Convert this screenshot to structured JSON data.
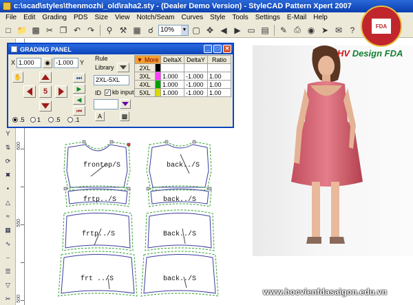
{
  "window": {
    "title": "c:\\scad\\styles\\thenmozhi_old\\raha2.sty - (Dealer Demo Version) - StyleCAD Pattern Xpert 2007"
  },
  "menu": [
    "File",
    "Edit",
    "Grading",
    "PDS",
    "Size",
    "View",
    "Notch/Seam",
    "Curves",
    "Style",
    "Tools",
    "Settings",
    "E-Mail",
    "Help"
  ],
  "toolbar": {
    "zoom": "10%"
  },
  "ruler": {
    "labels": [
      "600",
      "550",
      "500"
    ]
  },
  "grading_panel": {
    "title": "GRADING PANEL",
    "x_value": "1.000",
    "x_label": "X",
    "y_value": "-1.000",
    "y_label": "Y",
    "center_digit": "5",
    "rule_label": "Rule",
    "library_label": "Library",
    "rule_value": "2XL-5XL",
    "id_label": "ID",
    "kb_input_label": "kb input",
    "a_button": "A",
    "radios": [
      ".5",
      "1",
      ".5",
      ".1"
    ],
    "table": {
      "more_label": "More",
      "headers": [
        "DeltaX",
        "DeltaY",
        "Ratio"
      ],
      "rows": [
        {
          "size": "2XL",
          "color": "#000000",
          "dx": "",
          "dy": "",
          "ratio": ""
        },
        {
          "size": "3XL",
          "color": "#ff40ff",
          "dx": "1.000",
          "dy": "-1.000",
          "ratio": "1.00"
        },
        {
          "size": "4XL",
          "color": "#00a000",
          "dx": "1.000",
          "dy": "-1.000",
          "ratio": "1.00"
        },
        {
          "size": "5XL",
          "color": "#d8d800",
          "dx": "1.000",
          "dy": "-1.000",
          "ratio": "1.00"
        }
      ]
    }
  },
  "pieces": {
    "front_top": "frontop/S",
    "back_top": "back../S",
    "front_2": "frtp../S",
    "back_2": "back../S",
    "front_3": "frtp../S",
    "back_3": "Back../S",
    "front_4": "frt ../S",
    "back_4": "back../S"
  },
  "brand": {
    "hv": "HV",
    "design": "Design FDA"
  },
  "logo": {
    "text": "FDA"
  },
  "website": "www.hocvienfdasaigon.edu.vn",
  "colors": {
    "title_blue": "#0b3fb0",
    "dress_pink": "#d86a78",
    "brand_red": "#d01818",
    "brand_green": "#108030"
  }
}
